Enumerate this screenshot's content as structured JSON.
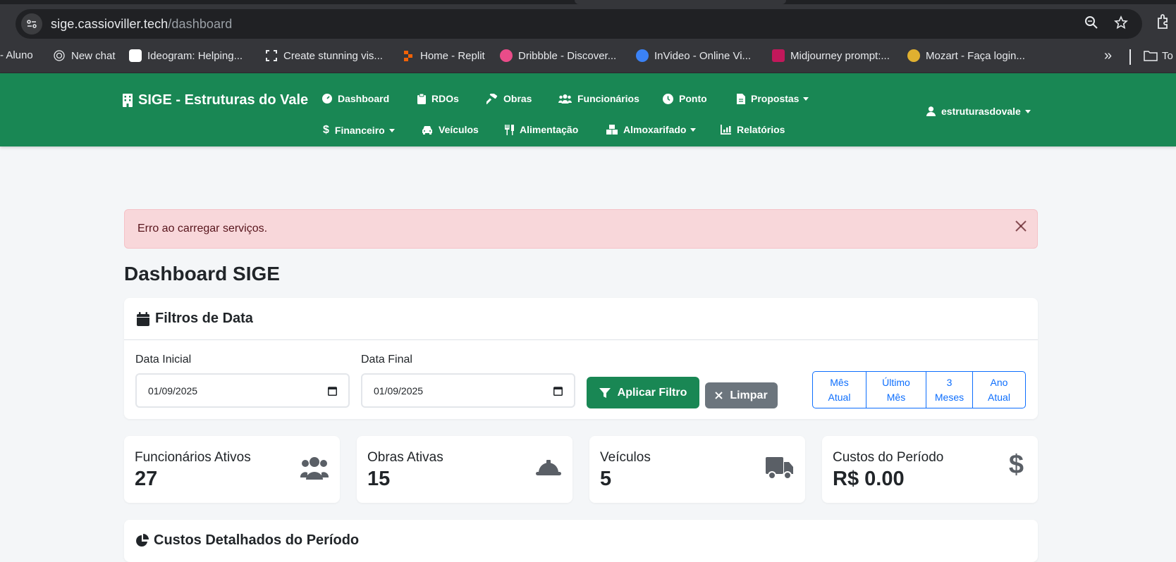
{
  "browser": {
    "url_host": "sige.cassioviller.tech",
    "url_path": "/dashboard",
    "bookmarks": [
      {
        "label": "- Aluno",
        "icon": "none"
      },
      {
        "label": "New chat",
        "icon": "openai-icon"
      },
      {
        "label": "Ideogram: Helping...",
        "icon": "ideogram-icon"
      },
      {
        "label": "Create stunning vis...",
        "icon": "frame-icon"
      },
      {
        "label": "Home - Replit",
        "icon": "replit-icon"
      },
      {
        "label": "Dribbble - Discover...",
        "icon": "dribbble-icon"
      },
      {
        "label": "InVideo - Online Vi...",
        "icon": "invideo-icon"
      },
      {
        "label": "Midjourney prompt:...",
        "icon": "midjourney-icon"
      },
      {
        "label": "Mozart - Faça login...",
        "icon": "mozart-icon"
      }
    ],
    "more_label": "»",
    "folder_label": "To"
  },
  "navbar": {
    "brand": "SIGE - Estruturas do Vale",
    "items": {
      "dashboard": "Dashboard",
      "rdos": "RDOs",
      "obras": "Obras",
      "funcionarios": "Funcionários",
      "ponto": "Ponto",
      "propostas": "Propostas",
      "financeiro": "Financeiro",
      "veiculos": "Veículos",
      "alimentacao": "Alimentação",
      "almoxarifado": "Almoxarifado",
      "relatorios": "Relatórios"
    },
    "user": "estruturasdovale"
  },
  "alert": {
    "message": "Erro ao carregar serviços."
  },
  "page": {
    "title": "Dashboard SIGE"
  },
  "filters": {
    "title": "Filtros de Data",
    "start_label": "Data Inicial",
    "start_value": "01/09/2025",
    "end_label": "Data Final",
    "end_value": "01/09/2025",
    "apply_label": "Aplicar Filtro",
    "clear_label": "Limpar",
    "quick": [
      {
        "line1": "Mês",
        "line2": "Atual"
      },
      {
        "line1": "Último",
        "line2": "Mês"
      },
      {
        "line1": "3",
        "line2": "Meses"
      },
      {
        "line1": "Ano",
        "line2": "Atual"
      }
    ]
  },
  "stats": [
    {
      "label": "Funcionários Ativos",
      "value": "27",
      "icon": "users-icon"
    },
    {
      "label": "Obras Ativas",
      "value": "15",
      "icon": "hard-hat-icon"
    },
    {
      "label": "Veículos",
      "value": "5",
      "icon": "truck-icon"
    },
    {
      "label": "Custos do Período",
      "value": "R$ 0.00",
      "icon": "dollar-icon"
    }
  ],
  "costs": {
    "title": "Custos Detalhados do Período"
  },
  "colors": {
    "primary_green": "#198754",
    "alert_bg": "#f8d7da",
    "link_blue": "#0d6efd",
    "secondary_gray": "#6c757d"
  }
}
